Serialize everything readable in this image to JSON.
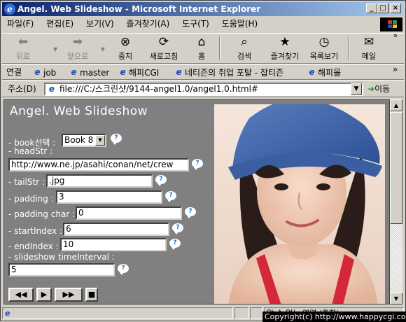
{
  "window": {
    "title": "Angel. Web Slideshow - Microsoft Internet Explorer",
    "minimize": "_",
    "maximize": "□",
    "close": "×"
  },
  "menu": [
    "파일(F)",
    "편집(E)",
    "보기(V)",
    "즐겨찾기(A)",
    "도구(T)",
    "도움말(H)"
  ],
  "toolbar": {
    "back": "뒤로",
    "forward": "앞으로",
    "stop": "중지",
    "refresh": "새로고침",
    "home": "홈",
    "search": "검색",
    "favorites": "즐겨찾기",
    "history": "목록보기",
    "mail": "메일"
  },
  "links": {
    "label": "연결",
    "items": [
      "job",
      "master",
      "해피CGI",
      "네티즌의 취업 포탈 - 잡티즌",
      "해피몰"
    ],
    "more": "»"
  },
  "address": {
    "label": "주소(D)",
    "url": "file:///C:/스크린샷/9144-angel1.0/angel1.0.html#",
    "go": "이동"
  },
  "page": {
    "title": "Angel. Web Slideshow",
    "book_label": "- book선택 :",
    "book_value": "Book 8",
    "headstr_label": "- headStr :",
    "headstr_value": "http://www.ne.jp/asahi/conan/net/crew",
    "tailstr_label": "- tailStr :",
    "tailstr_value": ".jpg",
    "padding_label": "- padding :",
    "padding_value": "3",
    "paddingchar_label": "- padding char :",
    "paddingchar_value": "0",
    "startindex_label": "- startIndex :",
    "startindex_value": "6",
    "endindex_label": "- endIndex :",
    "endindex_value": "10",
    "interval_label": "- slideshow timeInterval :",
    "interval_value": "5",
    "help_glyph": "?",
    "controls": {
      "prev": "◀◀",
      "play": "▶",
      "next": "▶▶",
      "stop": "■"
    }
  },
  "status": {
    "zone": "알 수 없는 영역 (혼합)",
    "copyright": "Copyright(c) http://www.happycgi.com"
  },
  "colors": {
    "titlebar_start": "#0a246a",
    "titlebar_end": "#a6caf0",
    "chrome": "#d4d0c8",
    "page_bg": "#808080"
  }
}
